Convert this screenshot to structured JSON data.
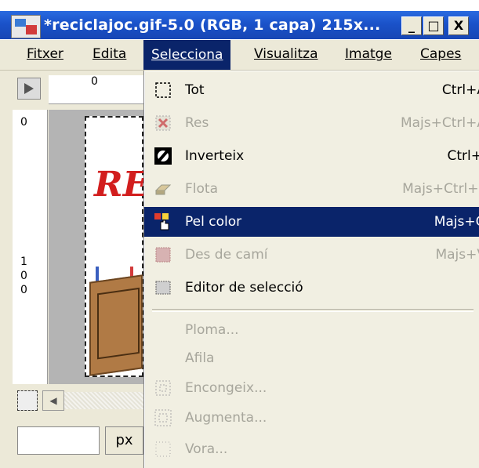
{
  "window": {
    "title": "*reciclajoc.gif-5.0 (RGB, 1 capa) 215x...",
    "buttons": {
      "minimize": "_",
      "maximize": "□",
      "close": "X"
    }
  },
  "menubar": {
    "items": [
      "Fitxer",
      "Edita",
      "Selecciona",
      "Visualitza",
      "Imatge",
      "Capes"
    ],
    "active": "Selecciona"
  },
  "rulers": {
    "top_zero": "0",
    "left_zero": "0",
    "left_hundred": [
      "1",
      "0",
      "0"
    ]
  },
  "statusbar": {
    "unit": "px"
  },
  "selecciona_menu": {
    "items": [
      {
        "label": "Tot",
        "shortcut": "Ctrl+A",
        "icon": "select-all-icon",
        "enabled": true
      },
      {
        "label": "Res",
        "shortcut": "Majs+Ctrl+A",
        "icon": "select-none-icon",
        "enabled": false
      },
      {
        "label": "Inverteix",
        "shortcut": "Ctrl+I",
        "icon": "invert-icon",
        "enabled": true
      },
      {
        "label": "Flota",
        "shortcut": "Majs+Ctrl+L",
        "icon": "float-icon",
        "enabled": false
      },
      {
        "label": "Pel color",
        "shortcut": "Majs+O",
        "icon": "by-color-icon",
        "enabled": true,
        "selected": true
      },
      {
        "label": "Des de camí",
        "shortcut": "Majs+V",
        "icon": "from-path-icon",
        "enabled": false
      },
      {
        "label": "Editor de selecció",
        "shortcut": "",
        "icon": "selection-editor-icon",
        "enabled": true
      },
      {
        "label": "Ploma...",
        "shortcut": "",
        "icon": "",
        "enabled": false
      },
      {
        "label": "Afila",
        "shortcut": "",
        "icon": "",
        "enabled": false
      },
      {
        "label": "Encongeix...",
        "shortcut": "",
        "icon": "shrink-icon",
        "enabled": false
      },
      {
        "label": "Augmenta...",
        "shortcut": "",
        "icon": "grow-icon",
        "enabled": false
      },
      {
        "label": "Vora...",
        "shortcut": "",
        "icon": "border-icon",
        "enabled": false
      }
    ]
  },
  "image_content": {
    "logo_text": "RE"
  }
}
